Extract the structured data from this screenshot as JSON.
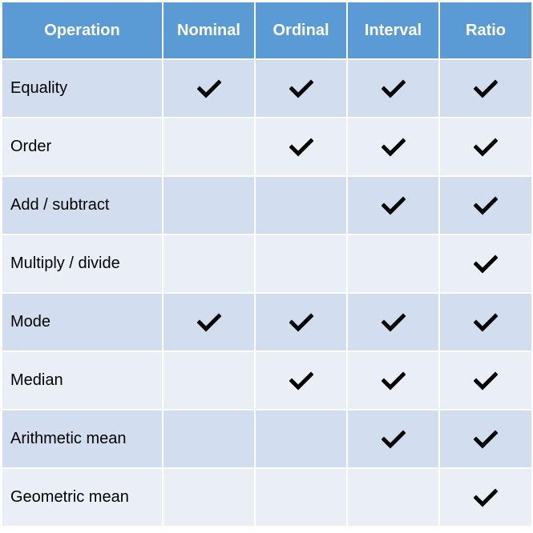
{
  "table": {
    "headers": [
      "Operation",
      "Nominal",
      "Ordinal",
      "Interval",
      "Ratio"
    ],
    "check_icon": "checkmark-icon",
    "rows": [
      {
        "operation": "Equality",
        "marks": [
          true,
          true,
          true,
          true
        ]
      },
      {
        "operation": "Order",
        "marks": [
          false,
          true,
          true,
          true
        ]
      },
      {
        "operation": "Add / subtract",
        "marks": [
          false,
          false,
          true,
          true
        ]
      },
      {
        "operation": "Multiply / divide",
        "marks": [
          false,
          false,
          false,
          true
        ]
      },
      {
        "operation": "Mode",
        "marks": [
          true,
          true,
          true,
          true
        ]
      },
      {
        "operation": "Median",
        "marks": [
          false,
          true,
          true,
          true
        ]
      },
      {
        "operation": "Arithmetic mean",
        "marks": [
          false,
          false,
          true,
          true
        ]
      },
      {
        "operation": "Geometric mean",
        "marks": [
          false,
          false,
          false,
          true
        ]
      }
    ]
  },
  "colors": {
    "header_bg": "#5B9BD5",
    "row_odd_bg": "#D2DEEF",
    "row_even_bg": "#EAEFF7",
    "border": "#FFFFFF"
  }
}
